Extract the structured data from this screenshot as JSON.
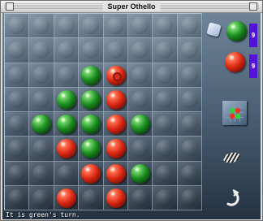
{
  "window": {
    "title": "Super Othello"
  },
  "board": {
    "rows": [
      [
        "",
        "",
        "",
        "",
        "",
        "",
        "",
        ""
      ],
      [
        "",
        "",
        "",
        "",
        "",
        "",
        "",
        ""
      ],
      [
        "",
        "",
        "",
        "green",
        "red-last",
        "",
        "",
        ""
      ],
      [
        "",
        "",
        "green",
        "green",
        "red",
        "",
        "",
        ""
      ],
      [
        "",
        "green",
        "green",
        "green",
        "red",
        "green",
        "",
        ""
      ],
      [
        "",
        "",
        "red",
        "green",
        "red",
        "",
        "",
        ""
      ],
      [
        "",
        "",
        "",
        "red",
        "red",
        "green",
        "",
        ""
      ],
      [
        "",
        "",
        "red",
        "",
        "red",
        "",
        "",
        ""
      ]
    ]
  },
  "scores": {
    "green": "9",
    "red": "9"
  },
  "status": "It is green's turn.",
  "icons": {
    "cube": "cube-icon",
    "miniboard": "mini-board-icon",
    "disc": "striped-disc-icon",
    "undo": "undo-arrow-icon"
  },
  "colors": {
    "green": "#1b8d1e",
    "red": "#d72511",
    "score_bar": "#5411d8"
  }
}
